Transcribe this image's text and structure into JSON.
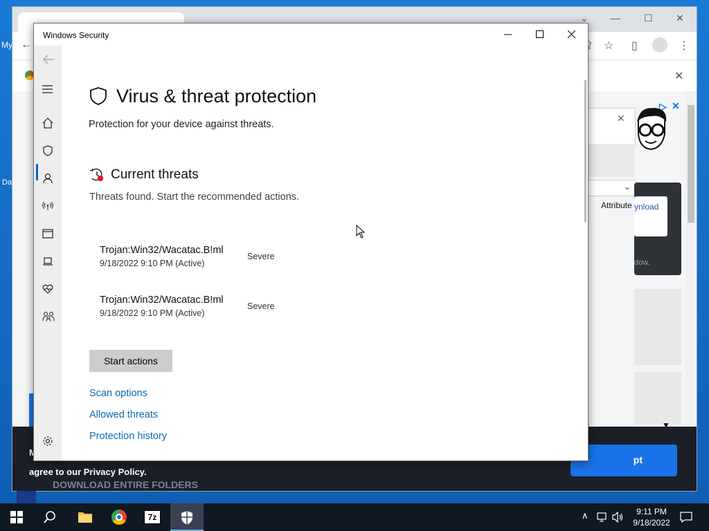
{
  "desktop": {
    "labels": [
      "My",
      "Da"
    ]
  },
  "browser": {
    "tab_title": "",
    "infobar_close": "✕",
    "ad": {
      "download_text": "ynload",
      "attribute_text": "Attribute",
      "window_text": "dow.",
      "close_symbol": "✕"
    },
    "banner": {
      "privacy_text": "agree to our Privacy Policy.",
      "download_folders": "DOWNLOAD ENTIRE FOLDERS",
      "accept_label": "pt",
      "first_letter": "M"
    }
  },
  "window": {
    "title": "Windows Security",
    "nav": [
      {
        "name": "back-arrow-icon"
      },
      {
        "name": "hamburger-icon"
      },
      {
        "name": "home-icon"
      },
      {
        "name": "shield-icon"
      },
      {
        "name": "account-icon"
      },
      {
        "name": "network-icon"
      },
      {
        "name": "app-browser-icon"
      },
      {
        "name": "laptop-icon"
      },
      {
        "name": "heart-icon"
      },
      {
        "name": "family-icon"
      },
      {
        "name": "gear-icon"
      }
    ],
    "heading": "Virus & threat protection",
    "subheading": "Protection for your device against threats.",
    "section_title": "Current threats",
    "section_subtitle": "Threats found. Start the recommended actions.",
    "threats": [
      {
        "name": "Trojan:Win32/Wacatac.B!ml",
        "date": "9/18/2022 9:10 PM (Active)",
        "severity": "Severe"
      },
      {
        "name": "Trojan:Win32/Wacatac.B!ml",
        "date": "9/18/2022 9:10 PM (Active)",
        "severity": "Severe"
      }
    ],
    "start_button": "Start actions",
    "links": [
      "Scan options",
      "Allowed threats",
      "Protection history"
    ]
  },
  "taskbar": {
    "items": [
      "start",
      "search",
      "file-explorer",
      "chrome",
      "7zip",
      "windows-security"
    ],
    "seven_zip_label": "7z",
    "time": "9:11 PM",
    "date": "9/18/2022"
  },
  "colors": {
    "accent": "#0067c0",
    "link": "#0a6ab6",
    "threat_badge": "#e81123",
    "taskbar": "#101824",
    "desktop": "#1a7ad6"
  }
}
